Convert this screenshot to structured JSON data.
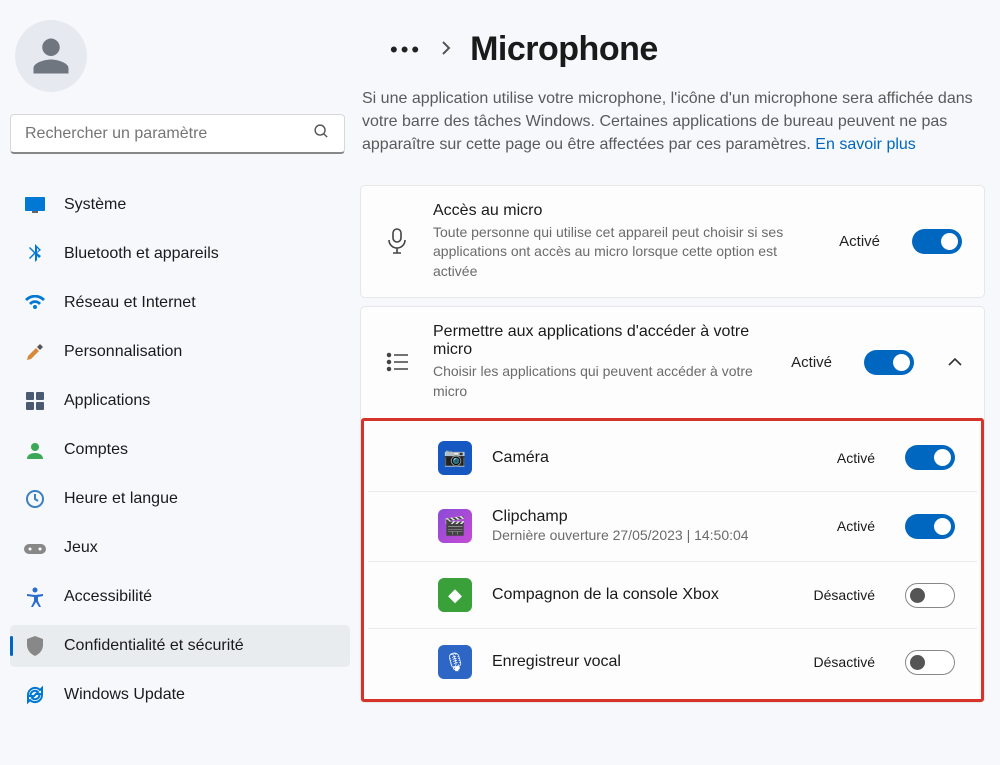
{
  "search": {
    "placeholder": "Rechercher un paramètre"
  },
  "sidebar": {
    "items": [
      {
        "label": "Système"
      },
      {
        "label": "Bluetooth et appareils"
      },
      {
        "label": "Réseau et Internet"
      },
      {
        "label": "Personnalisation"
      },
      {
        "label": "Applications"
      },
      {
        "label": "Comptes"
      },
      {
        "label": "Heure et langue"
      },
      {
        "label": "Jeux"
      },
      {
        "label": "Accessibilité"
      },
      {
        "label": "Confidentialité et sécurité"
      },
      {
        "label": "Windows Update"
      }
    ]
  },
  "header": {
    "title": "Microphone"
  },
  "description": {
    "text": "Si une application utilise votre microphone, l'icône d'un microphone sera affichée dans votre barre des tâches Windows. Certaines applications de bureau peuvent ne pas apparaître sur cette page ou être affectées par ces paramètres.  ",
    "link": "En savoir plus"
  },
  "cards": {
    "access": {
      "title": "Accès au micro",
      "desc": "Toute personne qui utilise cet appareil peut choisir si ses applications ont accès au micro lorsque cette option est activée",
      "status": "Activé"
    },
    "allow": {
      "title": "Permettre aux applications d'accéder à votre micro",
      "desc": "Choisir les applications qui peuvent accéder à votre micro",
      "status": "Activé"
    }
  },
  "apps": [
    {
      "title": "Caméra",
      "sub": "",
      "status": "Activé",
      "on": true,
      "icon_bg": "#1757c2",
      "icon_glyph": "📷"
    },
    {
      "title": "Clipchamp",
      "sub": "Dernière ouverture 27/05/2023  |  14:50:04",
      "status": "Activé",
      "on": true,
      "icon_bg": "#8a4bd6",
      "icon_glyph": "🎬"
    },
    {
      "title": "Compagnon de la console Xbox",
      "sub": "",
      "status": "Désactivé",
      "on": false,
      "icon_bg": "#3aa03a",
      "icon_glyph": "◆"
    },
    {
      "title": "Enregistreur vocal",
      "sub": "",
      "status": "Désactivé",
      "on": false,
      "icon_bg": "#2e66c5",
      "icon_glyph": "🎙"
    }
  ]
}
